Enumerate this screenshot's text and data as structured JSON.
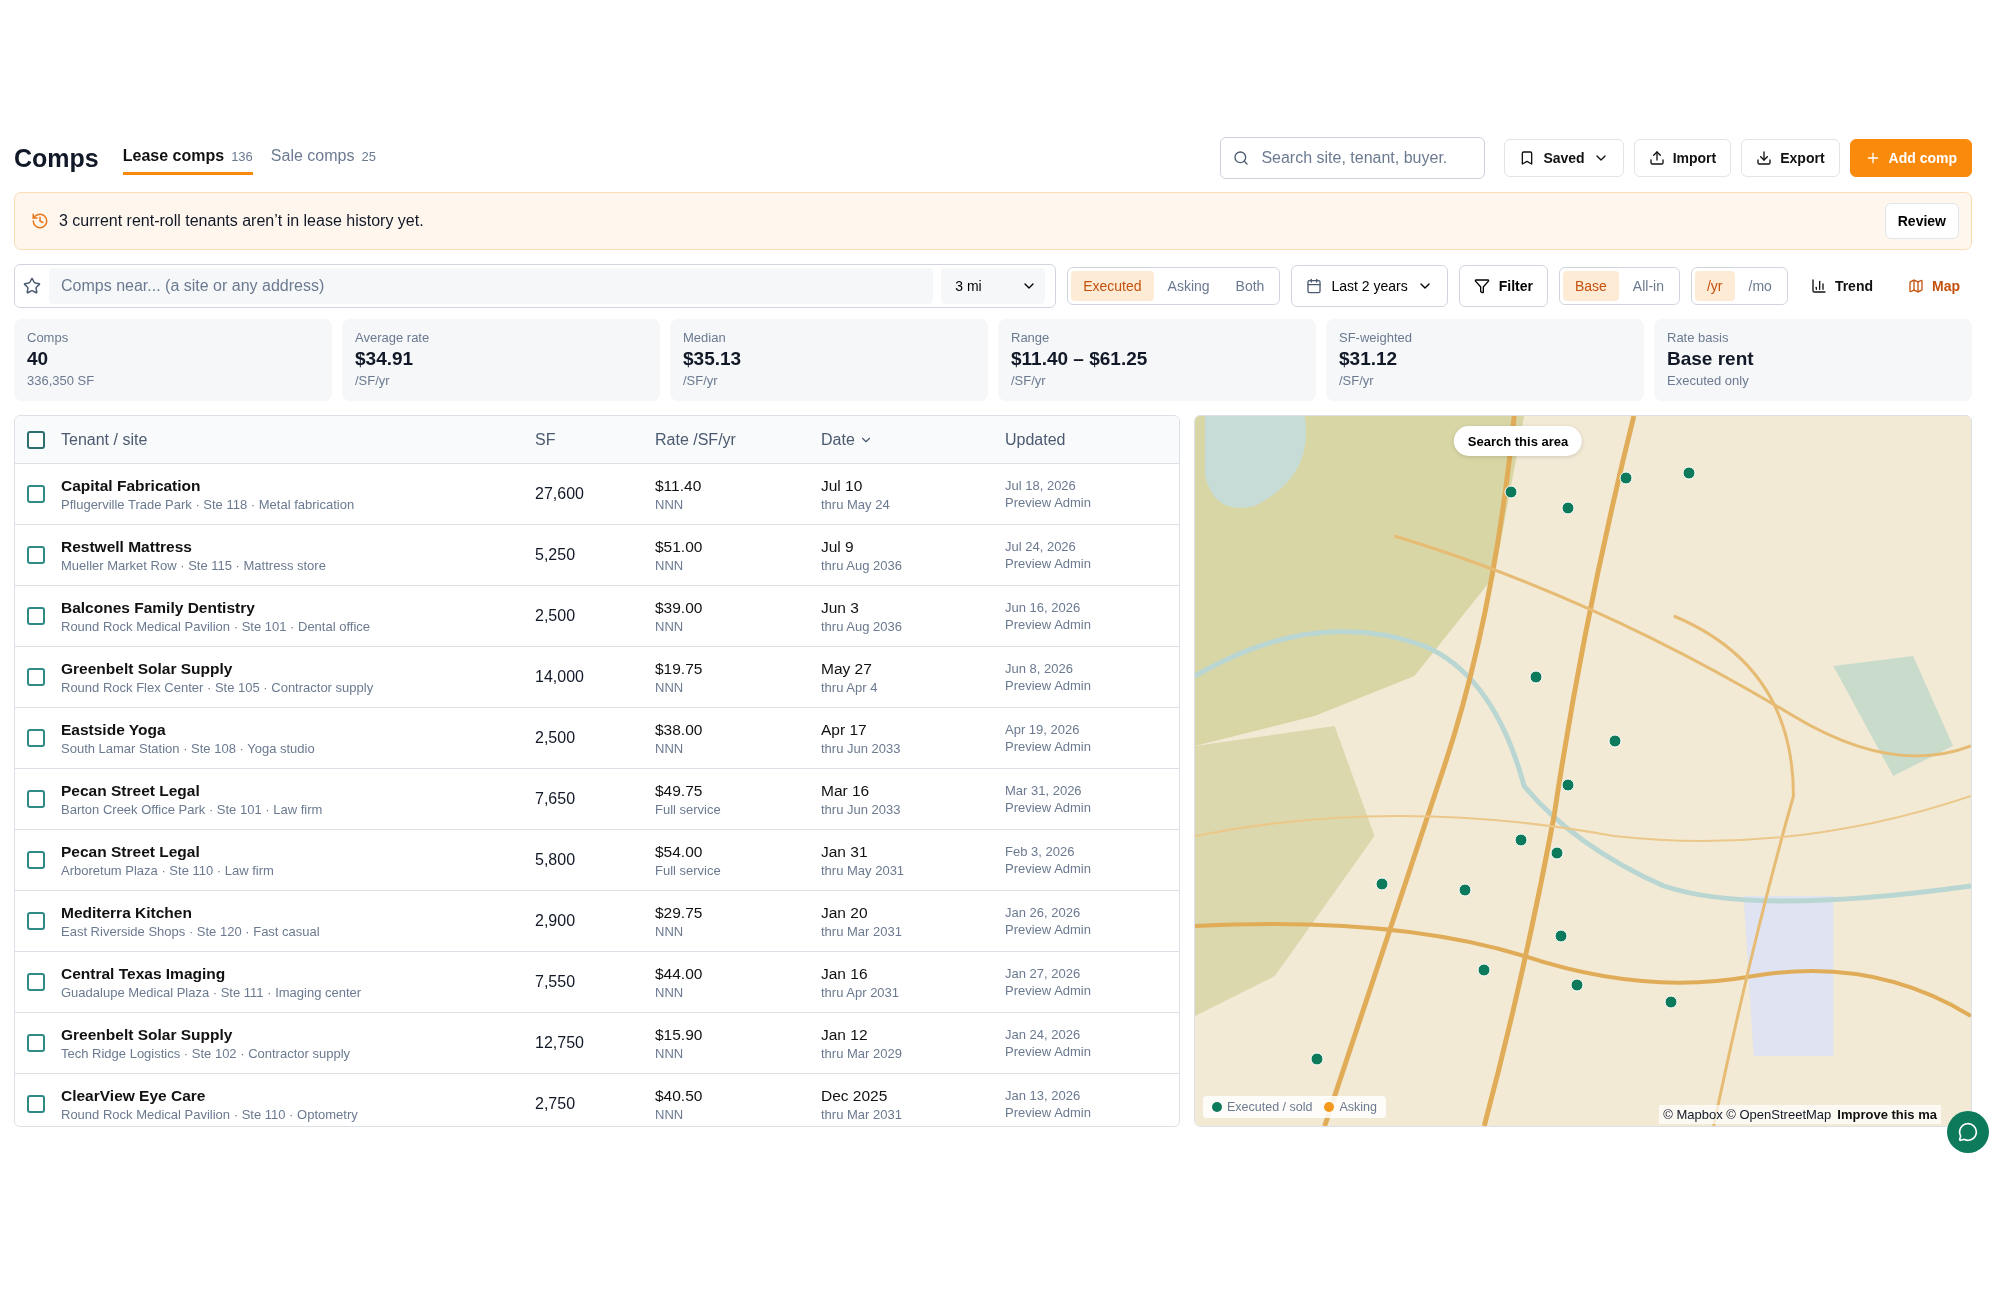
{
  "header": {
    "title": "Comps",
    "tabs": [
      {
        "label": "Lease comps",
        "count": "136",
        "selected": true
      },
      {
        "label": "Sale comps",
        "count": "25",
        "selected": false
      }
    ],
    "search": {
      "placeholder": "Search site, tenant, buyer."
    },
    "actions": [
      {
        "kind": "saved",
        "label": "Saved"
      },
      {
        "kind": "import",
        "label": "Import"
      },
      {
        "kind": "export",
        "label": "Export"
      },
      {
        "kind": "primary",
        "label": "Add comp"
      }
    ]
  },
  "banner": {
    "message": "3 current rent-roll tenants aren’t in lease history yet.",
    "action": "Review"
  },
  "filters": {
    "location": {
      "placeholder": "Comps near... (a site or any address)",
      "radius": "3 mi"
    },
    "status": [
      {
        "label": "Executed",
        "selected": true
      },
      {
        "label": "Asking",
        "selected": false
      },
      {
        "label": "Both",
        "selected": false
      }
    ],
    "period": "Last 2 years",
    "filter": "Filter",
    "basis": [
      {
        "label": "Base",
        "selected": true
      },
      {
        "label": "All-in",
        "selected": false
      }
    ],
    "unit": [
      {
        "label": "/yr",
        "selected": true
      },
      {
        "label": "/mo",
        "selected": false
      }
    ],
    "views": [
      {
        "kind": "trend",
        "label": "Trend",
        "selected": false
      },
      {
        "kind": "map",
        "label": "Map",
        "selected": true
      }
    ]
  },
  "stats": [
    {
      "label": "Comps",
      "value": "40",
      "sub": "336,350 SF"
    },
    {
      "label": "Average rate",
      "value": "$34.91",
      "sub": "/SF/yr"
    },
    {
      "label": "Median",
      "value": "$35.13",
      "sub": "/SF/yr"
    },
    {
      "label": "Range",
      "value": "$11.40 – $61.25",
      "sub": "/SF/yr"
    },
    {
      "label": "SF-weighted",
      "value": "$31.12",
      "sub": "/SF/yr"
    },
    {
      "label": "Rate basis",
      "value": "Base rent",
      "sub": "Executed only"
    }
  ],
  "table": {
    "all_checked": false,
    "columns": [
      {
        "label": "Tenant / site",
        "sorted": false
      },
      {
        "label": "SF",
        "sorted": false
      },
      {
        "label": "Rate /SF/yr",
        "sorted": false
      },
      {
        "label": "Date",
        "sorted": true
      },
      {
        "label": "Updated",
        "sorted": false
      }
    ],
    "rows": [
      {
        "tenant": "Capital Fabrication",
        "site": "Pflugerville Trade Park · Ste 118 · Metal fabrication",
        "sf": "27,600",
        "rate": "$11.40",
        "rate_type": "NNN",
        "date": "Jul 10",
        "term": "thru May 24",
        "updated": "Jul 18, 2026",
        "updated_by": "Preview Admin",
        "checked": false
      },
      {
        "tenant": "Restwell Mattress",
        "site": "Mueller Market Row · Ste 115 · Mattress store",
        "sf": "5,250",
        "rate": "$51.00",
        "rate_type": "NNN",
        "date": "Jul 9",
        "term": "thru Aug 2036",
        "updated": "Jul 24, 2026",
        "updated_by": "Preview Admin",
        "checked": false
      },
      {
        "tenant": "Balcones Family Dentistry",
        "site": "Round Rock Medical Pavilion · Ste 101 · Dental office",
        "sf": "2,500",
        "rate": "$39.00",
        "rate_type": "NNN",
        "date": "Jun 3",
        "term": "thru Aug 2036",
        "updated": "Jun 16, 2026",
        "updated_by": "Preview Admin",
        "checked": false
      },
      {
        "tenant": "Greenbelt Solar Supply",
        "site": "Round Rock Flex Center · Ste 105 · Contractor supply",
        "sf": "14,000",
        "rate": "$19.75",
        "rate_type": "NNN",
        "date": "May 27",
        "term": "thru Apr 4",
        "updated": "Jun 8, 2026",
        "updated_by": "Preview Admin",
        "checked": false
      },
      {
        "tenant": "Eastside Yoga",
        "site": "South Lamar Station · Ste 108 · Yoga studio",
        "sf": "2,500",
        "rate": "$38.00",
        "rate_type": "NNN",
        "date": "Apr 17",
        "term": "thru Jun 2033",
        "updated": "Apr 19, 2026",
        "updated_by": "Preview Admin",
        "checked": false
      },
      {
        "tenant": "Pecan Street Legal",
        "site": "Barton Creek Office Park · Ste 101 · Law firm",
        "sf": "7,650",
        "rate": "$49.75",
        "rate_type": "Full service",
        "date": "Mar 16",
        "term": "thru Jun 2033",
        "updated": "Mar 31, 2026",
        "updated_by": "Preview Admin",
        "checked": false
      },
      {
        "tenant": "Pecan Street Legal",
        "site": "Arboretum Plaza · Ste 110 · Law firm",
        "sf": "5,800",
        "rate": "$54.00",
        "rate_type": "Full service",
        "date": "Jan 31",
        "term": "thru May 2031",
        "updated": "Feb 3, 2026",
        "updated_by": "Preview Admin",
        "checked": false
      },
      {
        "tenant": "Mediterra Kitchen",
        "site": "East Riverside Shops · Ste 120 · Fast casual",
        "sf": "2,900",
        "rate": "$29.75",
        "rate_type": "NNN",
        "date": "Jan 20",
        "term": "thru Mar 2031",
        "updated": "Jan 26, 2026",
        "updated_by": "Preview Admin",
        "checked": false
      },
      {
        "tenant": "Central Texas Imaging",
        "site": "Guadalupe Medical Plaza · Ste 111 · Imaging center",
        "sf": "7,550",
        "rate": "$44.00",
        "rate_type": "NNN",
        "date": "Jan 16",
        "term": "thru Apr 2031",
        "updated": "Jan 27, 2026",
        "updated_by": "Preview Admin",
        "checked": false
      },
      {
        "tenant": "Greenbelt Solar Supply",
        "site": "Tech Ridge Logistics · Ste 102 · Contractor supply",
        "sf": "12,750",
        "rate": "$15.90",
        "rate_type": "NNN",
        "date": "Jan 12",
        "term": "thru Mar 2029",
        "updated": "Jan 24, 2026",
        "updated_by": "Preview Admin",
        "checked": false
      },
      {
        "tenant": "ClearView Eye Care",
        "site": "Round Rock Medical Pavilion · Ste 110 · Optometry",
        "sf": "2,750",
        "rate": "$40.50",
        "rate_type": "NNN",
        "date": "Dec 2025",
        "term": "thru Mar 2031",
        "updated": "Jan 13, 2026",
        "updated_by": "Preview Admin",
        "checked": false
      }
    ]
  },
  "map": {
    "search_button": "Search this area",
    "legend": [
      {
        "label": "Executed / sold",
        "color": "#0e7a5c"
      },
      {
        "label": "Asking",
        "color": "#f39a1c"
      }
    ],
    "attribution": "© Mapbox © OpenStreetMap",
    "improve_link": "Improve this ma"
  }
}
